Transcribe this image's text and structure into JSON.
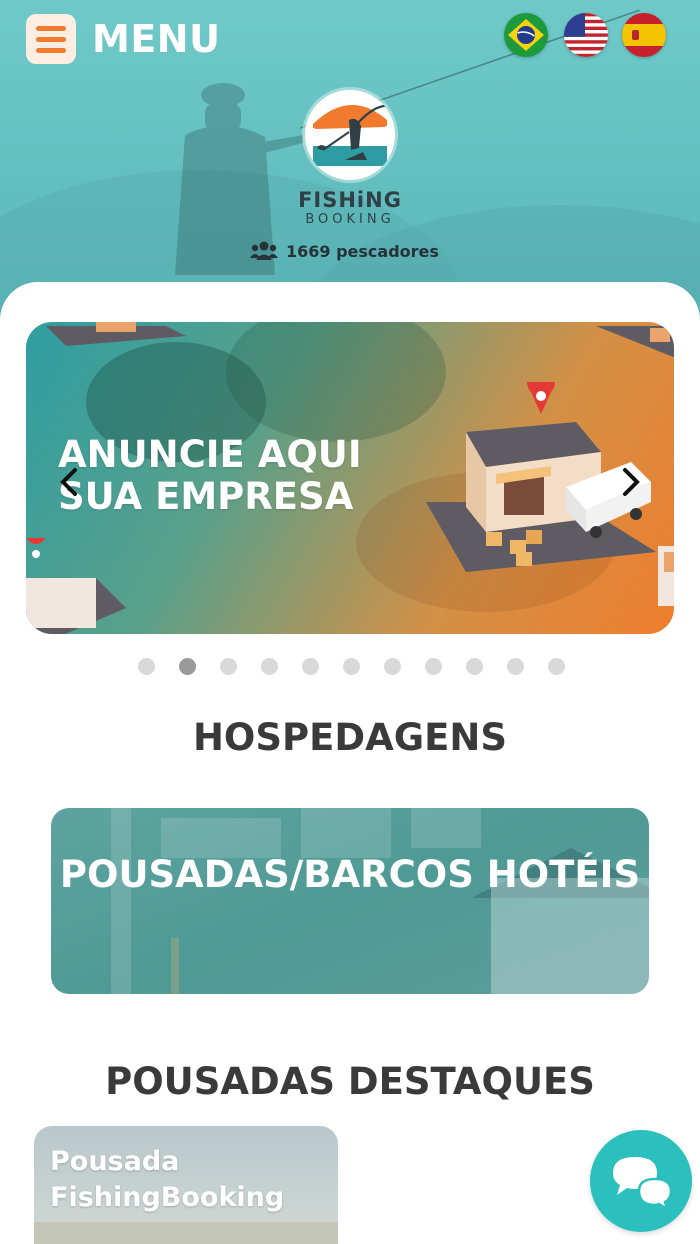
{
  "header": {
    "menu_label": "MENU",
    "menu_icon": "hamburger-icon",
    "languages": [
      {
        "code": "pt-BR",
        "icon": "brazil-flag-icon"
      },
      {
        "code": "en-US",
        "icon": "usa-flag-icon"
      },
      {
        "code": "es",
        "icon": "spain-flag-icon"
      }
    ],
    "brand_line1": "FISHiNG",
    "brand_line2": "BOOKING",
    "fishers_count": "1669 pescadores",
    "fishers_icon": "users-icon"
  },
  "carousel": {
    "slide_title": "ANUNCIE AQUI SUA EMPRESA",
    "prev_icon": "chevron-left-icon",
    "next_icon": "chevron-right-icon",
    "dot_count": 11,
    "active_dot": 1
  },
  "lodging": {
    "section_title": "HOSPEDAGENS",
    "category_label": "POUSADAS/BARCOS HOTÉIS"
  },
  "featured": {
    "section_title": "POUSADAS DESTAQUES",
    "items": [
      {
        "name": "Pousada FishingBooking"
      }
    ]
  },
  "chat": {
    "icon": "chat-bubbles-icon"
  },
  "colors": {
    "teal": "#6fc9c9",
    "orange": "#f07a2e",
    "chat_teal": "#2bbfbd",
    "heading": "#3a3a3a"
  }
}
